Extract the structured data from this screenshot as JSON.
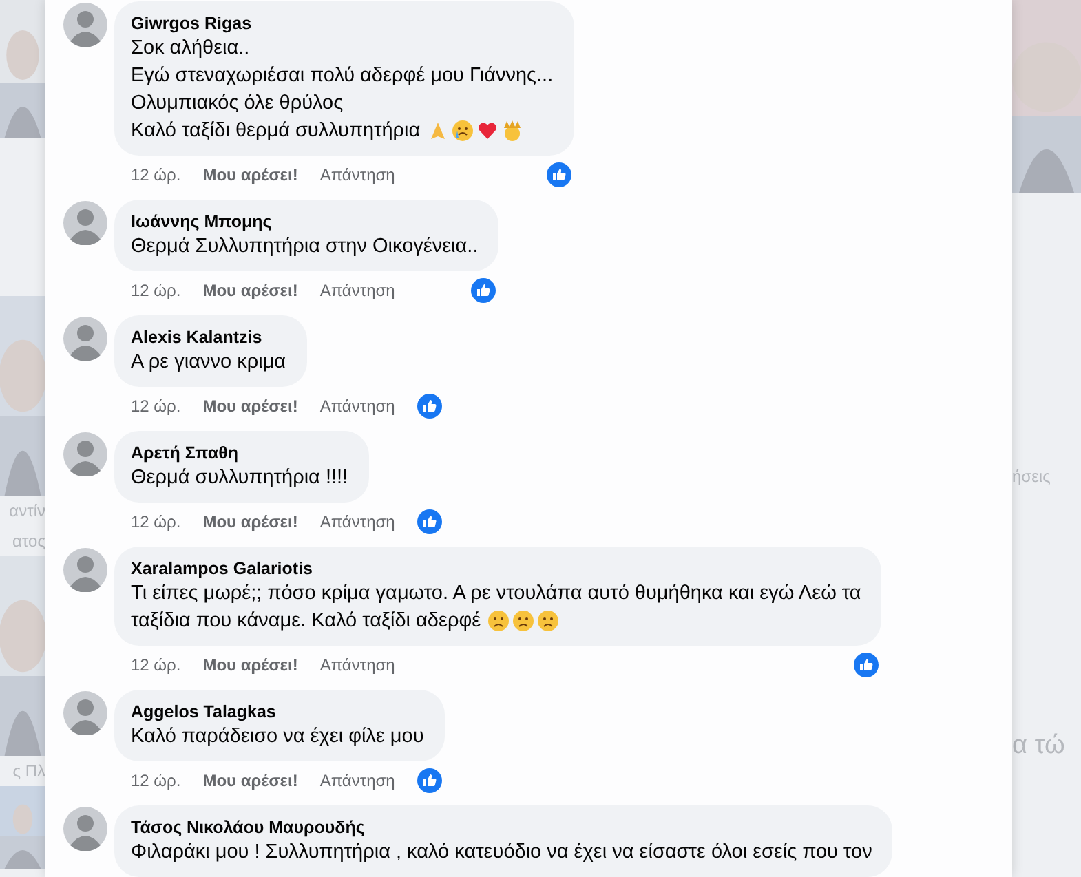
{
  "background": {
    "left_texts": [
      "αντίν",
      "ατος",
      "ς Πλ"
    ],
    "right_texts": [
      "ήσεις",
      "α τώ"
    ]
  },
  "comments": [
    {
      "author": "Giwrgos Rigas",
      "lines": [
        "Σοκ αλήθεια..",
        "Εγώ στεναχωριέσαι πολύ αδερφέ μου Γιάννης...",
        "Ολυμπιακός όλε θρύλος",
        "Καλό ταξίδι θερμά συλλυπητήρια"
      ],
      "emoji": [
        {
          "kind": "pray"
        },
        {
          "kind": "cry"
        },
        {
          "kind": "heart"
        },
        {
          "kind": "crown"
        }
      ],
      "time": "12 ώρ.",
      "like": "Μου αρέσει!",
      "reply": "Απάντηση",
      "liked": true
    },
    {
      "author": "Ιωάννης Μπομης",
      "lines": [
        "Θερμά Συλλυπητήρια στην Οικογένεια.."
      ],
      "time": "12 ώρ.",
      "like": "Μου αρέσει!",
      "reply": "Απάντηση",
      "liked": true
    },
    {
      "author": "Alexis Kalantzis",
      "lines": [
        "Α ρε γιαννο κριμα"
      ],
      "time": "12 ώρ.",
      "like": "Μου αρέσει!",
      "reply": "Απάντηση",
      "liked": true
    },
    {
      "author": "Αρετή Σπαθη",
      "lines": [
        "Θερμά συλλυπητήρια !!!!"
      ],
      "time": "12 ώρ.",
      "like": "Μου αρέσει!",
      "reply": "Απάντηση",
      "liked": true
    },
    {
      "author": "Xaralampos Galariotis",
      "lines": [
        "Τι είπες μωρέ;; πόσο κρίμα γαμωτο. Α ρε ντουλάπα αυτό θυμήθηκα και εγώ Λεώ τα",
        "ταξίδια που κάναμε. Καλό ταξίδι αδερφέ"
      ],
      "emoji": [
        {
          "kind": "sad"
        },
        {
          "kind": "sad"
        },
        {
          "kind": "sad"
        }
      ],
      "time": "12 ώρ.",
      "like": "Μου αρέσει!",
      "reply": "Απάντηση",
      "liked": true
    },
    {
      "author": "Aggelos Talagkas",
      "lines": [
        "Καλό παράδεισο να έχει φίλε μου"
      ],
      "time": "12 ώρ.",
      "like": "Μου αρέσει!",
      "reply": "Απάντηση",
      "liked": true
    },
    {
      "author": "Τάσος Νικολάου Μαυρουδής",
      "lines": [
        "Φιλαράκι μου ! Συλλυπητήρια , καλό κατευόδιο να έχει να είσαστε όλοι εσείς που τον"
      ]
    }
  ]
}
